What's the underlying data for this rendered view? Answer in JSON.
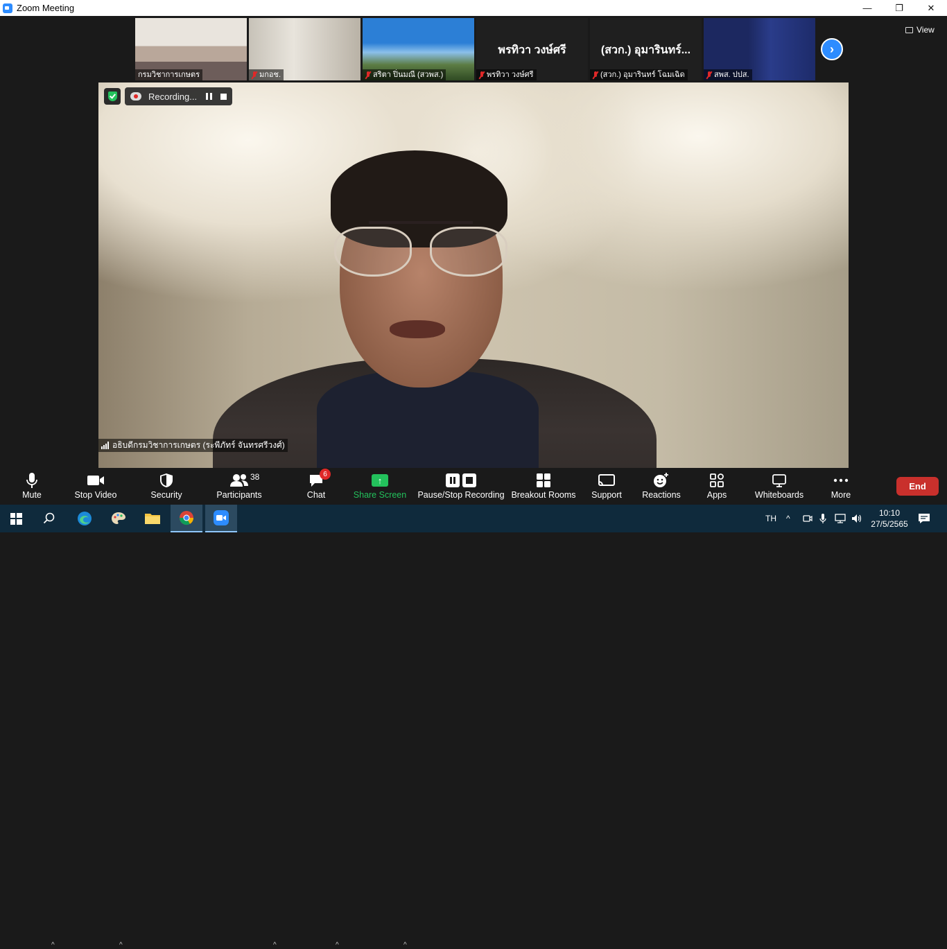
{
  "window": {
    "title": "Zoom Meeting",
    "minimize": "—",
    "restore": "❐",
    "close": "✕"
  },
  "gallery": {
    "view_label": "View",
    "thumbnails": [
      {
        "name": "กรมวิชาการเกษตร",
        "muted": false,
        "big_name": ""
      },
      {
        "name": "มกอช.",
        "muted": true,
        "big_name": ""
      },
      {
        "name": "สริตา ปิ่นมณี (สวพส.)",
        "muted": true,
        "big_name": ""
      },
      {
        "name": "พรทิวา วงษ์ศรี",
        "muted": true,
        "big_name": "พรทิวา วงษ์ศรี"
      },
      {
        "name": "(สวก.) อุมารินทร์ โฉมเฉิด",
        "muted": true,
        "big_name": "(สวก.) อุมารินทร์..."
      },
      {
        "name": "สพส. ปปส.",
        "muted": true,
        "big_name": ""
      }
    ],
    "next_icon": "chevron-right-icon"
  },
  "recording": {
    "label": "Recording..."
  },
  "speaker": {
    "name": "อธิบดีกรมวิชาการเกษตร (ระพีภัทร์ จันทรศรีวงศ์)"
  },
  "toolbar": {
    "mute": "Mute",
    "stop_video": "Stop Video",
    "security": "Security",
    "participants": "Participants",
    "participants_count": "38",
    "chat": "Chat",
    "chat_badge": "6",
    "share_screen": "Share Screen",
    "pause_stop_recording": "Pause/Stop Recording",
    "breakout_rooms": "Breakout Rooms",
    "support": "Support",
    "reactions": "Reactions",
    "apps": "Apps",
    "whiteboards": "Whiteboards",
    "more": "More",
    "end": "End"
  },
  "taskbar": {
    "language": "TH",
    "time": "10:10",
    "date": "27/5/2565"
  },
  "colors": {
    "accent": "#2d8cff",
    "share_green": "#23c15c",
    "end_red": "#c9302c",
    "muted_red": "#e02828"
  }
}
